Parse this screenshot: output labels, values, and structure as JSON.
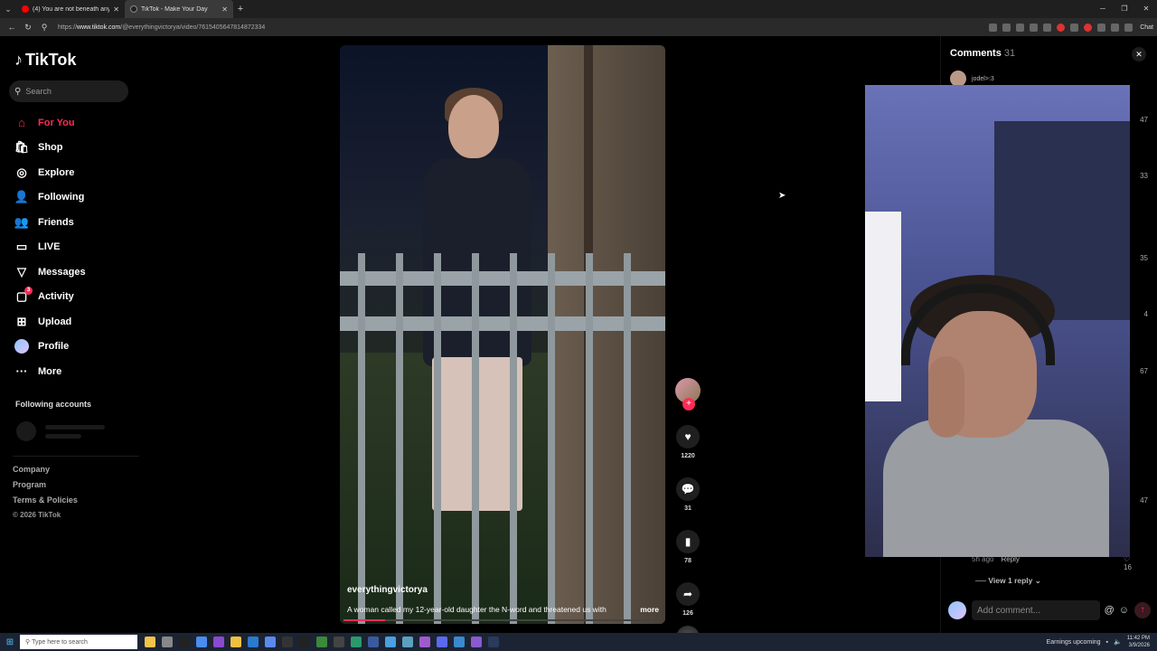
{
  "browser": {
    "tabs": [
      {
        "title": "(4) You are not beneath anything.",
        "favicon": "youtube-icon",
        "active": false
      },
      {
        "title": "TikTok - Make Your Day",
        "favicon": "tiktok-icon",
        "active": true
      }
    ],
    "url_prefix": "https://",
    "url_domain": "www.tiktok.com",
    "url_path": "/@everythingvictorya/video/7615405647814872334",
    "chat_label": "Chat"
  },
  "sidebar": {
    "logo_text": "TikTok",
    "search_placeholder": "Search",
    "items": [
      {
        "label": "For You",
        "icon": "home-icon"
      },
      {
        "label": "Shop",
        "icon": "shop-bag-icon"
      },
      {
        "label": "Explore",
        "icon": "compass-icon"
      },
      {
        "label": "Following",
        "icon": "following-icon"
      },
      {
        "label": "Friends",
        "icon": "friends-icon"
      },
      {
        "label": "LIVE",
        "icon": "live-icon"
      },
      {
        "label": "Messages",
        "icon": "paper-plane-icon"
      },
      {
        "label": "Activity",
        "icon": "activity-icon",
        "badge": "3"
      },
      {
        "label": "Upload",
        "icon": "upload-icon"
      },
      {
        "label": "Profile",
        "icon": "profile-avatar"
      },
      {
        "label": "More",
        "icon": "more-dots-icon"
      }
    ],
    "following_title": "Following accounts",
    "footer": [
      "Company",
      "Program",
      "Terms & Policies"
    ],
    "copyright": "© 2026 TikTok"
  },
  "video": {
    "username": "everythingvictorya",
    "description": "A woman called my 12-year-old daughter the N-word and threatened us with",
    "more_label": "more",
    "progress": 0.13
  },
  "actions": {
    "follow_label": "+",
    "likes": "1220",
    "comments": "31",
    "saves": "78",
    "shares": "126"
  },
  "comments": {
    "title": "Comments",
    "count": "31",
    "first_user": "jodel>:3",
    "like_counts": [
      "47",
      "33",
      "35",
      "4",
      "67",
      "47"
    ],
    "last_time": "5h ago",
    "reply_label": "Reply",
    "last_likes": "16",
    "view_replies": "View 1 reply",
    "add_placeholder": "Add comment...",
    "at_symbol": "@"
  },
  "taskbar": {
    "search_placeholder": "Type here to search",
    "weather": "Earnings upcoming",
    "time": "11:42 PM",
    "date": "3/9/2026"
  },
  "colors": {
    "accent": "#fe2c55",
    "background": "#000000"
  }
}
